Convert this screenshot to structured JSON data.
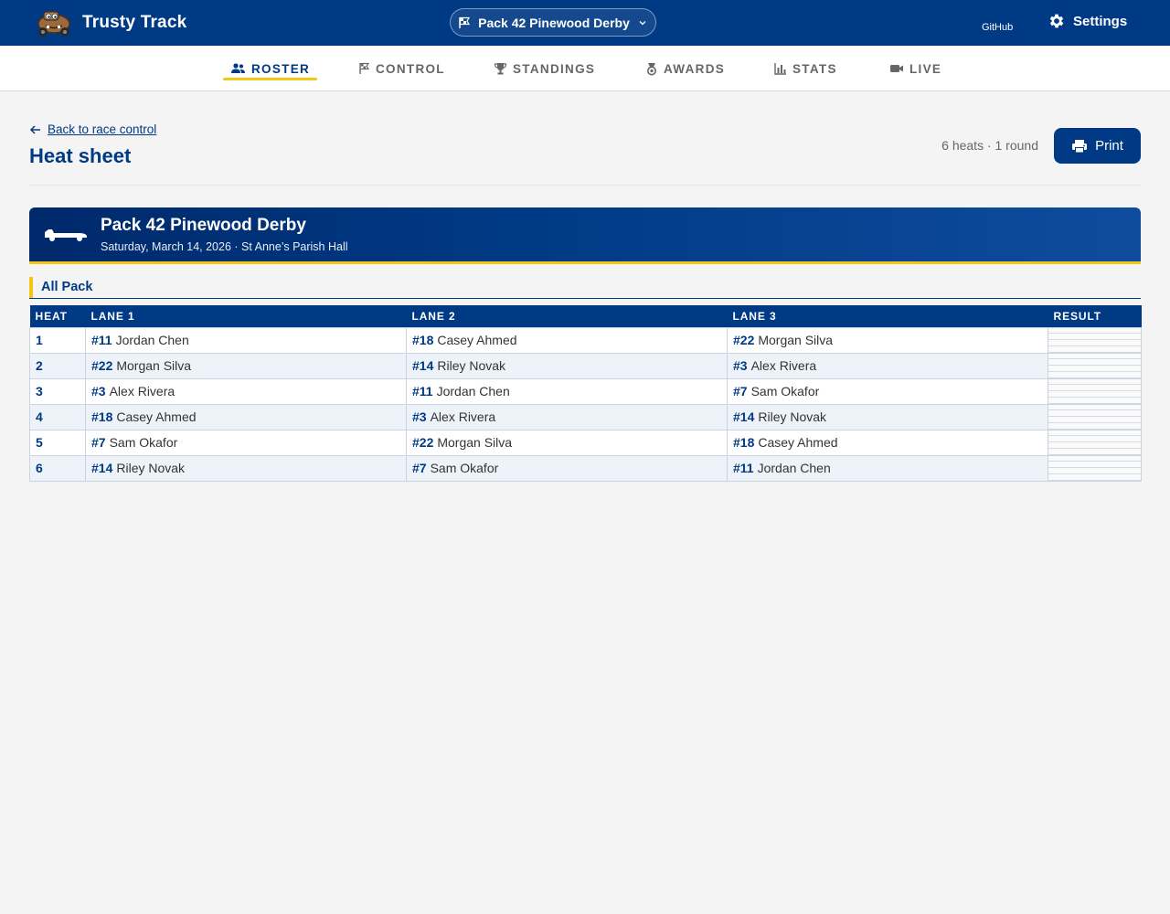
{
  "app": {
    "title": "Trusty Track"
  },
  "header": {
    "event_selector": "Pack 42 Pinewood Derby",
    "github_label": "GitHub",
    "settings_label": "Settings"
  },
  "nav": {
    "tabs": [
      {
        "label": "ROSTER",
        "icon": "people-icon",
        "active": true
      },
      {
        "label": "CONTROL",
        "icon": "flag-icon",
        "active": false
      },
      {
        "label": "STANDINGS",
        "icon": "trophy-icon",
        "active": false
      },
      {
        "label": "AWARDS",
        "icon": "medal-icon",
        "active": false
      },
      {
        "label": "STATS",
        "icon": "bar-chart-icon",
        "active": false
      },
      {
        "label": "LIVE",
        "icon": "video-icon",
        "active": false
      }
    ]
  },
  "page": {
    "back_link": "Back to race control",
    "title": "Heat sheet",
    "meta": "6 heats · 1 round",
    "print_label": "Print"
  },
  "event": {
    "name": "Pack 42 Pinewood Derby",
    "subtitle": "Saturday, March 14, 2026 · St Anne’s Parish Hall"
  },
  "group": {
    "label": "All Pack"
  },
  "table": {
    "columns": [
      "HEAT",
      "LANE 1",
      "LANE 2",
      "LANE 3",
      "RESULT"
    ],
    "rows": [
      {
        "heat": "1",
        "lanes": [
          {
            "car": "#11",
            "name": "Jordan Chen"
          },
          {
            "car": "#18",
            "name": "Casey Ahmed"
          },
          {
            "car": "#22",
            "name": "Morgan Silva"
          }
        ]
      },
      {
        "heat": "2",
        "lanes": [
          {
            "car": "#22",
            "name": "Morgan Silva"
          },
          {
            "car": "#14",
            "name": "Riley Novak"
          },
          {
            "car": "#3",
            "name": "Alex Rivera"
          }
        ]
      },
      {
        "heat": "3",
        "lanes": [
          {
            "car": "#3",
            "name": "Alex Rivera"
          },
          {
            "car": "#11",
            "name": "Jordan Chen"
          },
          {
            "car": "#7",
            "name": "Sam Okafor"
          }
        ]
      },
      {
        "heat": "4",
        "lanes": [
          {
            "car": "#18",
            "name": "Casey Ahmed"
          },
          {
            "car": "#3",
            "name": "Alex Rivera"
          },
          {
            "car": "#14",
            "name": "Riley Novak"
          }
        ]
      },
      {
        "heat": "5",
        "lanes": [
          {
            "car": "#7",
            "name": "Sam Okafor"
          },
          {
            "car": "#22",
            "name": "Morgan Silva"
          },
          {
            "car": "#18",
            "name": "Casey Ahmed"
          }
        ]
      },
      {
        "heat": "6",
        "lanes": [
          {
            "car": "#14",
            "name": "Riley Novak"
          },
          {
            "car": "#7",
            "name": "Sam Okafor"
          },
          {
            "car": "#11",
            "name": "Jordan Chen"
          }
        ]
      }
    ]
  },
  "colors": {
    "primary": "#003a85",
    "accent": "#f5c518",
    "background": "#f4f4f4"
  }
}
